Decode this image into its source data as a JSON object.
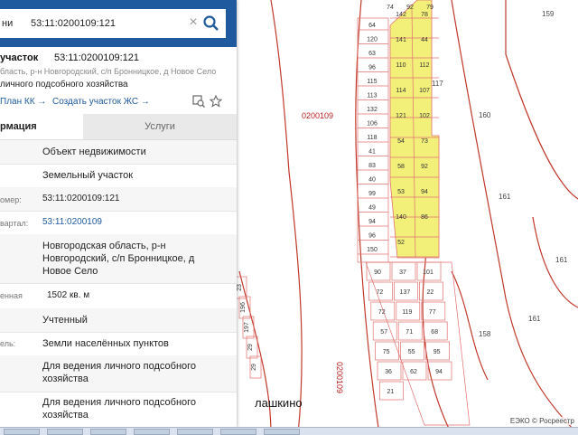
{
  "search": {
    "label": "ни",
    "value": "53:11:0200109:121",
    "clear_icon": "close-icon",
    "search_icon": "search-icon"
  },
  "object": {
    "type": "участок",
    "number": "53:11:0200109:121",
    "address": "бласть, р-н Новгородский, с/п Бронницкое, д Новое Село",
    "purpose": "личного подсобного хозяйства"
  },
  "links": {
    "plan": "План КК →",
    "create": "Создать участок ЖС →"
  },
  "tabs": {
    "info": "рмация",
    "services": "Услуги"
  },
  "rows": [
    {
      "label": "",
      "value": "Объект недвижимости"
    },
    {
      "label": "",
      "value": "Земельный участок"
    },
    {
      "label": "омер:",
      "value": "53:11:0200109:121"
    },
    {
      "label": "вартал:",
      "value": "53:11:0200109"
    },
    {
      "label": "",
      "value": "Новгородская область, р-н Новгородский, с/п Бронницкое, д Новое Село"
    },
    {
      "label": "енная",
      "value": "1502 кв. м"
    },
    {
      "label": "",
      "value": "Учтенный"
    },
    {
      "label": "ель:",
      "value": "Земли населённых пунктов"
    },
    {
      "label": "",
      "value": "Для ведения личного подсобного хозяйства"
    },
    {
      "label": "",
      "value": "Для ведения личного подсобного хозяйства"
    }
  ],
  "map": {
    "quarter_label": "0200109",
    "quarter_label_vertical": "0200109",
    "village": "лашкино",
    "attribution": "ЕЭКО © Росреестр",
    "parcel_labels": {
      "left_column": [
        "64",
        "120",
        "63",
        "96",
        "115",
        "113",
        "132",
        "106",
        "118",
        "41",
        "83",
        "40",
        "99",
        "49",
        "94",
        "96",
        "150"
      ],
      "highlighted": [
        "142",
        "78",
        "141",
        "44",
        "110",
        "112",
        "114",
        "107",
        "121",
        "102",
        "54",
        "73",
        "58",
        "92",
        "53",
        "94",
        "140",
        "86",
        "52"
      ],
      "lower": [
        "90",
        "37",
        "101",
        "72",
        "137",
        "22",
        "72",
        "119",
        "77",
        "57",
        "71",
        "68",
        "75",
        "55",
        "95",
        "36",
        "62",
        "94",
        "21"
      ],
      "top": [
        "74",
        "92",
        "79"
      ],
      "right": [
        "117",
        "159",
        "160",
        "161",
        "161",
        "158",
        "161"
      ],
      "far_left": [
        "23",
        "196",
        "197",
        "29",
        "29"
      ]
    },
    "colors": {
      "boundary": "#c0392b",
      "highlight": "#f3f07a",
      "parcel": "#e07070"
    }
  },
  "taskbar_buttons": 7
}
